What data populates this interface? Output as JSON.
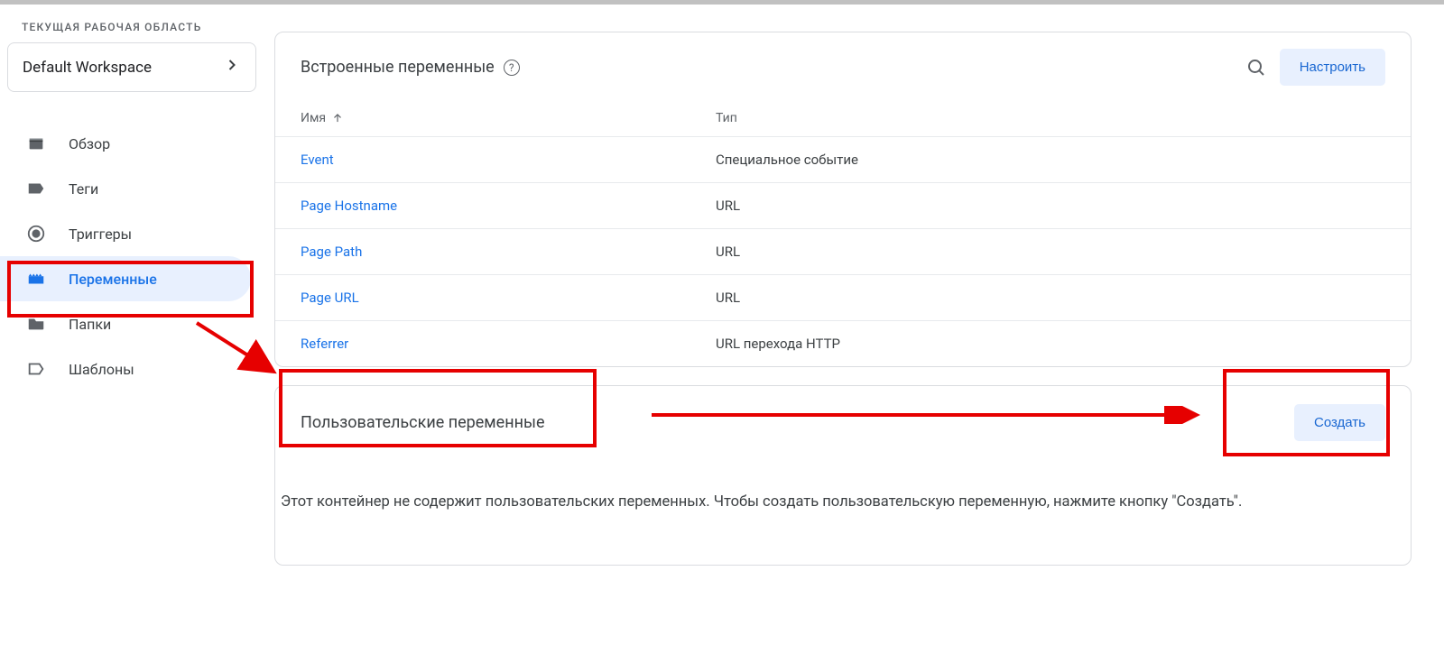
{
  "sidebar": {
    "workspace_label": "ТЕКУЩАЯ РАБОЧАЯ ОБЛАСТЬ",
    "workspace_name": "Default Workspace",
    "items": [
      {
        "label": "Обзор"
      },
      {
        "label": "Теги"
      },
      {
        "label": "Триггеры"
      },
      {
        "label": "Переменные"
      },
      {
        "label": "Папки"
      },
      {
        "label": "Шаблоны"
      }
    ]
  },
  "builtins": {
    "title": "Встроенные переменные",
    "configure_label": "Настроить",
    "col_name": "Имя",
    "col_type": "Тип",
    "rows": [
      {
        "name": "Event",
        "type": "Специальное событие"
      },
      {
        "name": "Page Hostname",
        "type": "URL"
      },
      {
        "name": "Page Path",
        "type": "URL"
      },
      {
        "name": "Page URL",
        "type": "URL"
      },
      {
        "name": "Referrer",
        "type": "URL перехода HTTP"
      }
    ]
  },
  "custom": {
    "title": "Пользовательские переменные",
    "create_label": "Создать",
    "empty_text": "Этот контейнер не содержит пользовательских переменных. Чтобы создать пользовательскую переменную, нажмите кнопку \"Создать\"."
  }
}
